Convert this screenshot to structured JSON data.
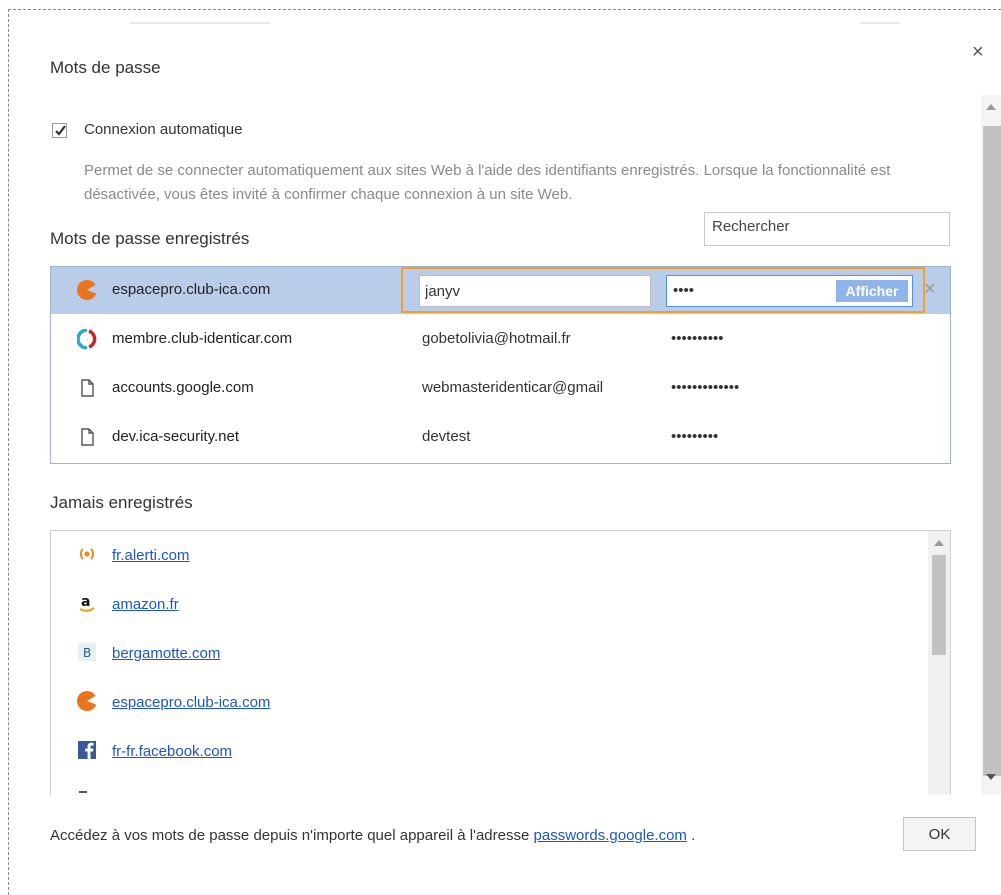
{
  "dialog": {
    "title": "Mots de passe"
  },
  "auto_signin": {
    "checked": true,
    "label": "Connexion automatique",
    "description": "Permet de se connecter automatiquement aux sites Web à l'aide des identifiants enregistrés. Lorsque la fonctionnalité est désactivée, vous êtes invité à confirmer chaque connexion à un site Web."
  },
  "saved": {
    "title": "Mots de passe enregistrés",
    "search_placeholder": "Rechercher",
    "rows": [
      {
        "site": "espacepro.club-ica.com",
        "user": "janyv",
        "password": "••••",
        "icon": "club-ica-icon",
        "selected": true
      },
      {
        "site": "membre.club-identicar.com",
        "user": "gobetolivia@hotmail.fr",
        "password": "••••••••••",
        "icon": "identicar-icon"
      },
      {
        "site": "accounts.google.com",
        "user": "webmasteridenticar@gmail",
        "password": "•••••••••••••",
        "icon": "page-icon"
      },
      {
        "site": "dev.ica-security.net",
        "user": "devtest",
        "password": "•••••••••",
        "icon": "page-icon"
      }
    ],
    "show_label": "Afficher",
    "delete_icon": "close-icon"
  },
  "never": {
    "title": "Jamais enregistrés",
    "items": [
      {
        "site": "fr.alerti.com",
        "icon": "alerti-icon"
      },
      {
        "site": "amazon.fr",
        "icon": "amazon-icon"
      },
      {
        "site": "bergamotte.com",
        "icon": "bergamotte-icon"
      },
      {
        "site": "espacepro.club-ica.com",
        "icon": "club-ica-icon"
      },
      {
        "site": "fr-fr.facebook.com",
        "icon": "facebook-icon"
      }
    ]
  },
  "footer": {
    "text_before": "Accédez à vos mots de passe depuis n'importe quel appareil à l'adresse ",
    "link": "passwords.google.com",
    "text_after": " .",
    "ok_label": "OK"
  },
  "colors": {
    "selected_row": "#b9cde9",
    "edit_outline": "#f0a030",
    "link": "#1c55cc",
    "show_button": "#8fb4ea"
  }
}
